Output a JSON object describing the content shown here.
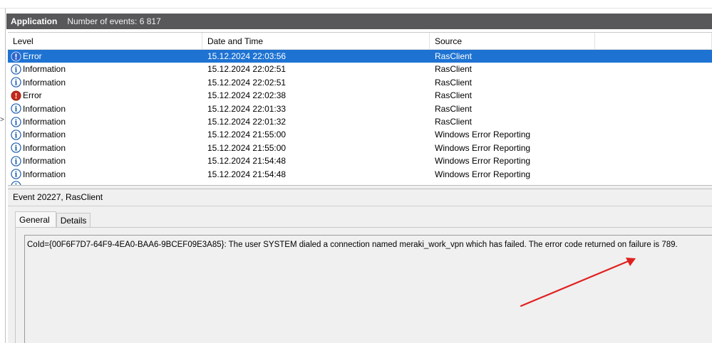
{
  "header": {
    "title": "Application",
    "event_count": "Number of events: 6 817"
  },
  "left_marker": ">",
  "columns": {
    "level": "Level",
    "date_time": "Date and Time",
    "source": "Source"
  },
  "events": [
    {
      "level": "Error",
      "icon": "info-icon",
      "date_time": "15.12.2024 22:03:56",
      "source": "RasClient",
      "selected": true
    },
    {
      "level": "Information",
      "icon": "info-icon",
      "date_time": "15.12.2024 22:02:51",
      "source": "RasClient"
    },
    {
      "level": "Information",
      "icon": "info-icon",
      "date_time": "15.12.2024 22:02:51",
      "source": "RasClient"
    },
    {
      "level": "Error",
      "icon": "error-icon",
      "date_time": "15.12.2024 22:02:38",
      "source": "RasClient"
    },
    {
      "level": "Information",
      "icon": "info-icon",
      "date_time": "15.12.2024 22:01:33",
      "source": "RasClient"
    },
    {
      "level": "Information",
      "icon": "info-icon",
      "date_time": "15.12.2024 22:01:32",
      "source": "RasClient"
    },
    {
      "level": "Information",
      "icon": "info-icon",
      "date_time": "15.12.2024 21:55:00",
      "source": "Windows Error Reporting"
    },
    {
      "level": "Information",
      "icon": "info-icon",
      "date_time": "15.12.2024 21:55:00",
      "source": "Windows Error Reporting"
    },
    {
      "level": "Information",
      "icon": "info-icon",
      "date_time": "15.12.2024 21:54:48",
      "source": "Windows Error Reporting"
    },
    {
      "level": "Information",
      "icon": "info-icon",
      "date_time": "15.12.2024 21:54:48",
      "source": "Windows Error Reporting"
    }
  ],
  "detail": {
    "title": "Event 20227, RasClient",
    "tabs": [
      "General",
      "Details"
    ],
    "active_tab": "General",
    "message": "CoId={00F6F7D7-64F9-4EA0-BAA6-9BCEF09E3A85}: The user SYSTEM dialed a connection named meraki_work_vpn which has failed. The error code returned on failure is 789."
  },
  "colors": {
    "header_bar": "#58585b",
    "selected_row": "#1e73d2",
    "info_icon": "#1f5fb0",
    "error_icon": "#c42b1c",
    "annotation_arrow": "#e02020"
  }
}
